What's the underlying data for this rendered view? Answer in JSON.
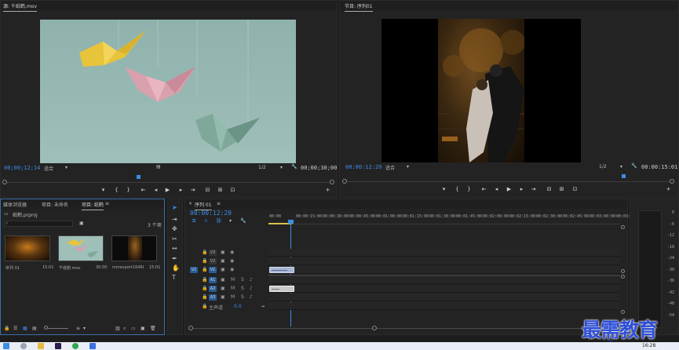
{
  "source_monitor": {
    "tab_label": "源: 千纸鹤.mov",
    "timecode_current": "00;00;12;14",
    "fit_label": "适合",
    "ratio_label": "1/2",
    "timecode_duration": "00;00;30;00"
  },
  "program_monitor": {
    "tab_label": "节目: 序列01",
    "timecode_current": "00:00:12:20",
    "fit_label": "适合",
    "ratio_label": "1/2",
    "timecode_duration": "00:00:15:01"
  },
  "transport_symbols": {
    "marker": "▾",
    "in": "{",
    "out": "}",
    "goto_in": "⇤",
    "step_back": "◂",
    "play": "▶",
    "step_fwd": "▸",
    "goto_out": "⇥",
    "insert": "⊟",
    "overwrite": "⊞",
    "camera": "⊡",
    "add": "+"
  },
  "project_panel": {
    "tabs": [
      "媒体浏览器",
      "项目: 未命名",
      "项目: 纸鹤"
    ],
    "project_file": "纸鹤.prproj",
    "item_count": "3 个项",
    "items": [
      {
        "name": "序列 01",
        "duration": "15:01"
      },
      {
        "name": "千纸鹤.mov",
        "duration": "30:00"
      },
      {
        "name": "mmexport1646000028...",
        "duration": "15:01"
      }
    ]
  },
  "timeline": {
    "tab_label": "序列 01",
    "timecode": "00:00:12:20",
    "ruler_labels": [
      "00:00",
      "00:00:15:00",
      "00:00:30:00",
      "00:00:45:00",
      "00:01:00:00",
      "00:01:15:00",
      "00:01:30:00",
      "00:01:45:00",
      "00:02:00:00",
      "00:02:15:00",
      "00:02:30:00",
      "00:02:45:00",
      "00:03:00:00",
      "00:03:15"
    ],
    "source_patch": "V1",
    "video_tracks": [
      "V3",
      "V2",
      "V1"
    ],
    "audio_tracks": [
      "A1",
      "A2",
      "A3"
    ],
    "master_label": "主声道",
    "master_value": "0.0",
    "mute_label": "M",
    "solo_label": "S"
  },
  "audio_meter": {
    "scale": [
      "0",
      "-6",
      "-12",
      "-18",
      "-24",
      "-30",
      "-36",
      "-42",
      "-48",
      "-54"
    ],
    "bottom_labels": [
      "S",
      "S"
    ]
  },
  "watermark": "最需教育",
  "taskbar": {
    "clock_time": "16:28",
    "ime": "中"
  },
  "colors": {
    "accent": "#3b8de6",
    "video_clip": "#a9b6d4",
    "audio_clip": "#c9c9c9",
    "playhead": "#3b8de6"
  }
}
